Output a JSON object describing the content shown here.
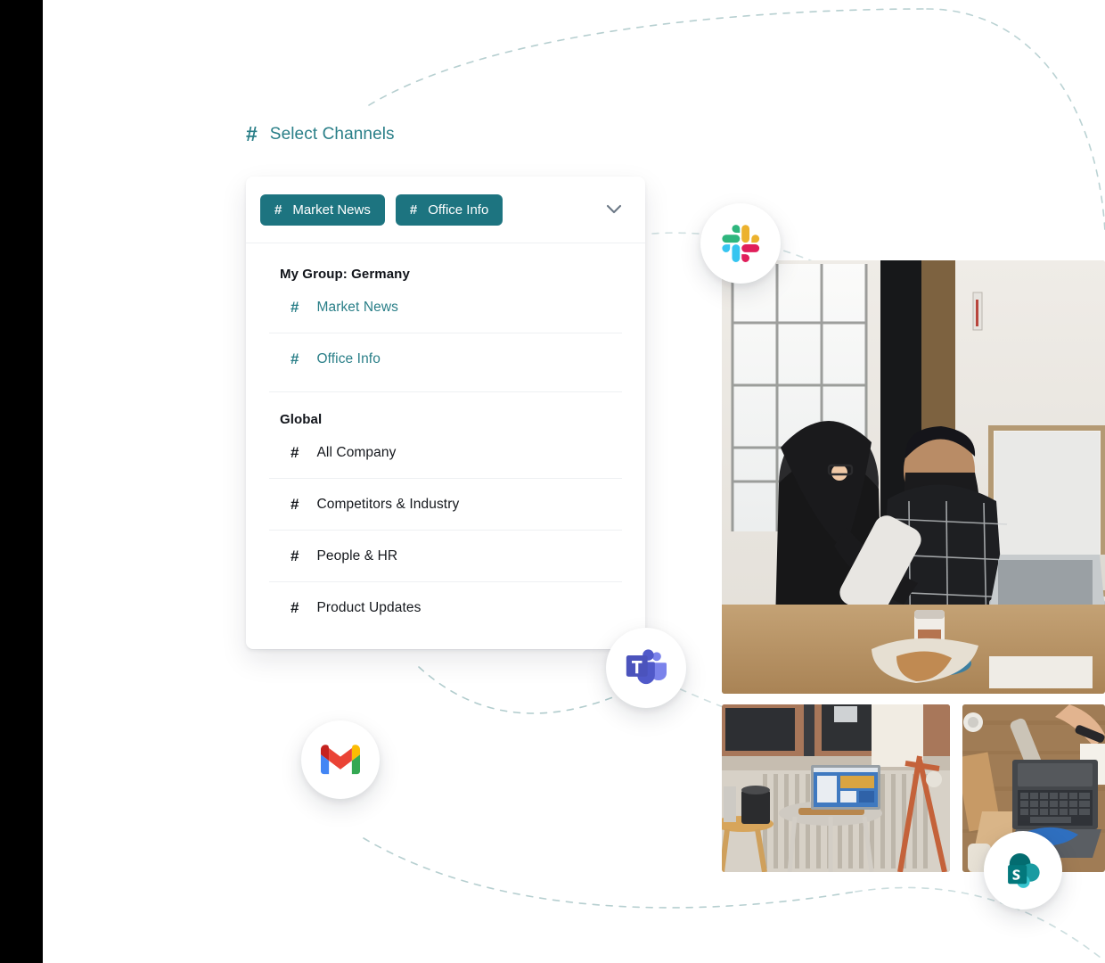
{
  "page": {
    "background_color": "#ffffff",
    "accent_color": "#1d7480",
    "accent_text_color": "#2a7f88",
    "divider_color": "#eef0f2",
    "dashed_curve_color": "#9fc3c4"
  },
  "section": {
    "hash_icon": "hash-icon",
    "title": "Select Channels"
  },
  "dropdown": {
    "chevron_icon": "chevron-down-icon",
    "selected_chips": [
      {
        "hash": "#",
        "label": "Market News"
      },
      {
        "hash": "#",
        "label": "Office Info"
      }
    ],
    "groups": [
      {
        "label": "My Group: Germany",
        "items": [
          {
            "hash": "#",
            "label": "Market News",
            "selected": true
          },
          {
            "hash": "#",
            "label": "Office Info",
            "selected": true
          }
        ]
      },
      {
        "label": "Global",
        "items": [
          {
            "hash": "#",
            "label": "All Company",
            "selected": false
          },
          {
            "hash": "#",
            "label": "Competitors & Industry",
            "selected": false
          },
          {
            "hash": "#",
            "label": "People & HR",
            "selected": false
          },
          {
            "hash": "#",
            "label": "Product Updates",
            "selected": false
          }
        ]
      }
    ]
  },
  "app_badges": [
    {
      "name": "slack-icon",
      "label": "Slack"
    },
    {
      "name": "microsoft-teams-icon",
      "label": "Microsoft Teams"
    },
    {
      "name": "gmail-icon",
      "label": "Gmail"
    },
    {
      "name": "sharepoint-icon",
      "label": "SharePoint"
    }
  ],
  "photos": [
    {
      "name": "photo-collaborators-loft",
      "alt": "Two colleagues working together at a table with a laptop in a loft studio"
    },
    {
      "name": "photo-tablet-on-stool",
      "alt": "Tablet propped on a stool in front of a radiator"
    },
    {
      "name": "photo-laptop-desk-overhead",
      "alt": "Overhead view of a laptop and drawing tools on a wooden desk"
    }
  ]
}
